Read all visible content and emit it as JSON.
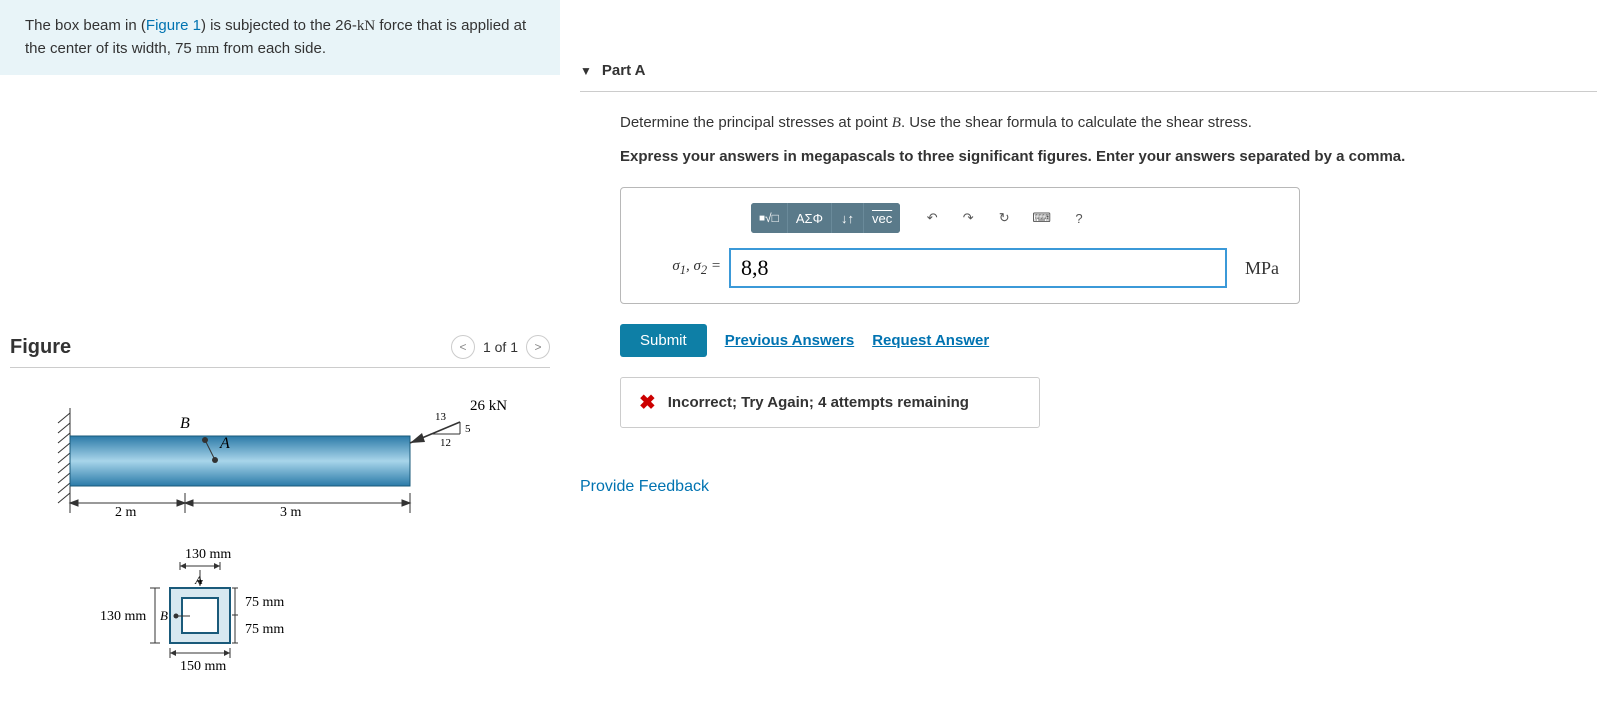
{
  "problem": {
    "text_pre": "The box beam in (",
    "figure_link": "Figure 1",
    "text_mid1": ") is subjected to the 26-",
    "unit_kn": "kN",
    "text_mid2": " force that is applied at the center of its width, 75 ",
    "unit_mm": "mm",
    "text_post": " from each side."
  },
  "figure": {
    "title": "Figure",
    "pager": "1 of 1",
    "beam": {
      "force": "26 kN",
      "ratio_top": "13",
      "ratio_right": "5",
      "ratio_bottom": "12",
      "point_a": "A",
      "point_b": "B",
      "dim_left": "2 m",
      "dim_right": "3 m"
    },
    "section": {
      "top_w": "130 mm",
      "left_h": "130 mm",
      "inner_h1": "75 mm",
      "inner_h2": "75 mm",
      "bottom_w": "150 mm",
      "label_a": "A",
      "label_b": "B"
    }
  },
  "part": {
    "header": "Part A",
    "instruction_pre": "Determine the principal stresses at point ",
    "instruction_point": "B",
    "instruction_post": ". Use the shear formula to calculate the shear stress.",
    "instruction2": "Express your answers in megapascals to three significant figures. Enter your answers separated by a comma.",
    "label_sigma": "σ₁, σ₂ = ",
    "input_value": "8,8",
    "unit": "MPa",
    "submit": "Submit",
    "prev_answers": "Previous Answers",
    "request_answer": "Request Answer",
    "feedback": "Incorrect; Try Again; 4 attempts remaining",
    "provide_feedback": "Provide Feedback"
  },
  "toolbar": {
    "templates": "□√□",
    "greek": "ΑΣΦ",
    "subscript": "↓↑",
    "vec": "vec",
    "undo": "↶",
    "redo": "↷",
    "reset": "↻",
    "keyboard": "⌨",
    "help": "?"
  }
}
